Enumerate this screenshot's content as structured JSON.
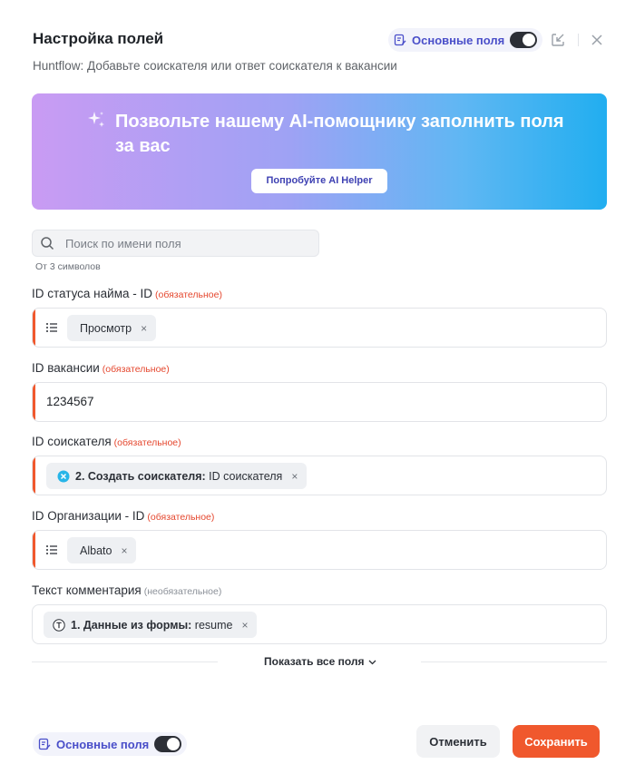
{
  "header": {
    "title": "Настройка полей",
    "subtitle": "Huntflow: Добавьте соискателя или ответ соискателя к вакансии",
    "basic_fields_label": "Основные поля"
  },
  "banner": {
    "text": "Позвольте нашему AI-помощнику заполнить поля за вас",
    "button_label": "Попробуйте AI Helper"
  },
  "search": {
    "placeholder": "Поиск по имени поля",
    "hint": "От 3 символов"
  },
  "fields": [
    {
      "label": "ID статуса найма - ID",
      "tag": "(обязательное)",
      "chip": {
        "value": "Просмотр"
      }
    },
    {
      "label": "ID вакансии",
      "tag": "(обязательное)",
      "value": "1234567"
    },
    {
      "label": "ID соискателя",
      "tag": "(обязательное)",
      "chip": {
        "prefix": "2. Создать соискателя:",
        "value": "ID соискателя"
      }
    },
    {
      "label": "ID Организации - ID",
      "tag": "(обязательное)",
      "chip": {
        "value": "Albato"
      }
    },
    {
      "label": "Текст комментария",
      "tag": "(необязательное)",
      "chip": {
        "prefix": "1. Данные из формы:",
        "value": "resume"
      }
    }
  ],
  "chip_remove_glyph": "×",
  "show_all_label": "Показать все поля",
  "footer": {
    "basic_fields_label": "Основные поля",
    "cancel_label": "Отменить",
    "save_label": "Сохранить"
  },
  "colors": {
    "accent": "#f0582d",
    "brand_purple": "#4a4fc9",
    "required": "#e5472e"
  }
}
